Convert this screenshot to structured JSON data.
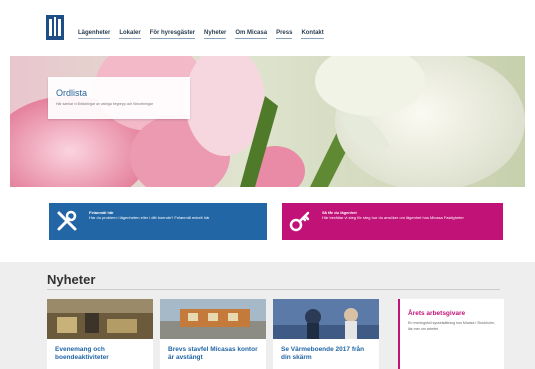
{
  "nav": {
    "items": [
      "Lägenheter",
      "Lokaler",
      "För hyresgäster",
      "Nyheter",
      "Om Micasa",
      "Press",
      "Kontakt"
    ]
  },
  "hero": {
    "title": "Ordlista",
    "subtitle": "Här samlar vi förklaringar av vanliga begrepp och förkortningar"
  },
  "tiles": [
    {
      "title": "Felanmäl här",
      "text": "Har du problem i lägenheten eller i ditt boende? Felanmäl enkelt här",
      "color": "#2266a5",
      "icon": "tools-icon"
    },
    {
      "title": "Så får du lägenhet",
      "text": "Här berättar vi steg för steg hur du ansöker om lägenhet hos Micasa Fastigheter",
      "color": "#c01277",
      "icon": "key-icon"
    }
  ],
  "news": {
    "heading": "Nyheter",
    "cards": [
      {
        "title": "Evenemang och boendeaktiviteter"
      },
      {
        "title": "Brevs stavfel Micasas kontor är avstängt"
      },
      {
        "title": "Se Värmeboende 2017 från din skärm"
      }
    ],
    "side": {
      "title": "Årets arbetsgivare",
      "text": "En meningsfull sysselsättning hos Micasa i Stockholm, läs mer om arbetet"
    }
  },
  "colors": {
    "primary": "#2266a5",
    "accent": "#c01277",
    "nav_text": "#2c3e50"
  }
}
